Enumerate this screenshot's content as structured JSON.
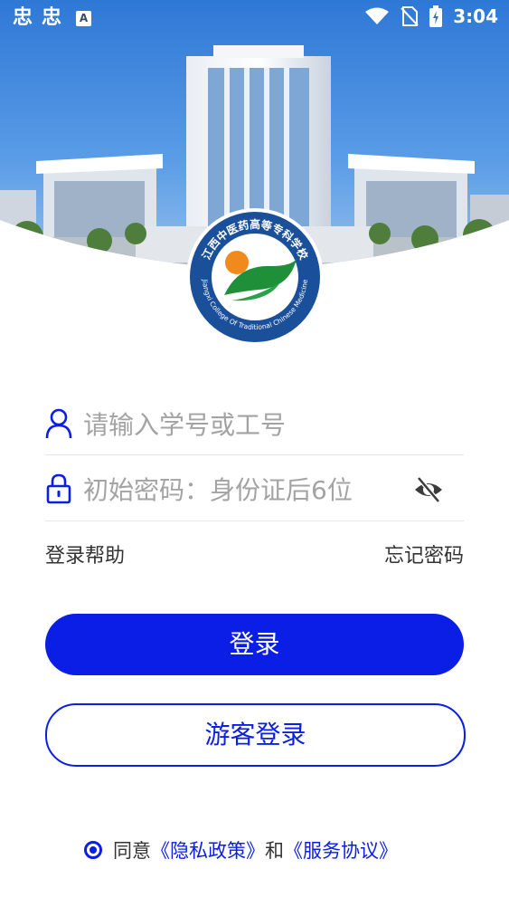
{
  "status_bar": {
    "left_glyphs": [
      "忠",
      "忠"
    ],
    "notification_icon": "A",
    "time": "3:04",
    "icons": [
      "wifi-icon",
      "no-sim-icon",
      "battery-charging-icon"
    ]
  },
  "hero": {
    "image": "campus-building-photo",
    "logo": {
      "arc_text_cn": "江西中医药高等专科学校",
      "arc_text_en": "Jiangxi College Of Traditional Chinese Medicine"
    }
  },
  "login_form": {
    "username_placeholder": "请输入学号或工号",
    "password_placeholder": "初始密码：身份证后6位",
    "help_link": "登录帮助",
    "forgot_link": "忘记密码",
    "login_button": "登录",
    "guest_button": "游客登录"
  },
  "agreement": {
    "prefix": "同意",
    "privacy_link": "《隐私政策》",
    "conjunction": "和",
    "service_link": "《服务协议》",
    "checked": true
  },
  "colors": {
    "primary": "#0a1ee6",
    "logo_blue": "#1a4f9a",
    "logo_green": "#1f8f3a",
    "logo_orange": "#f08a1c"
  }
}
